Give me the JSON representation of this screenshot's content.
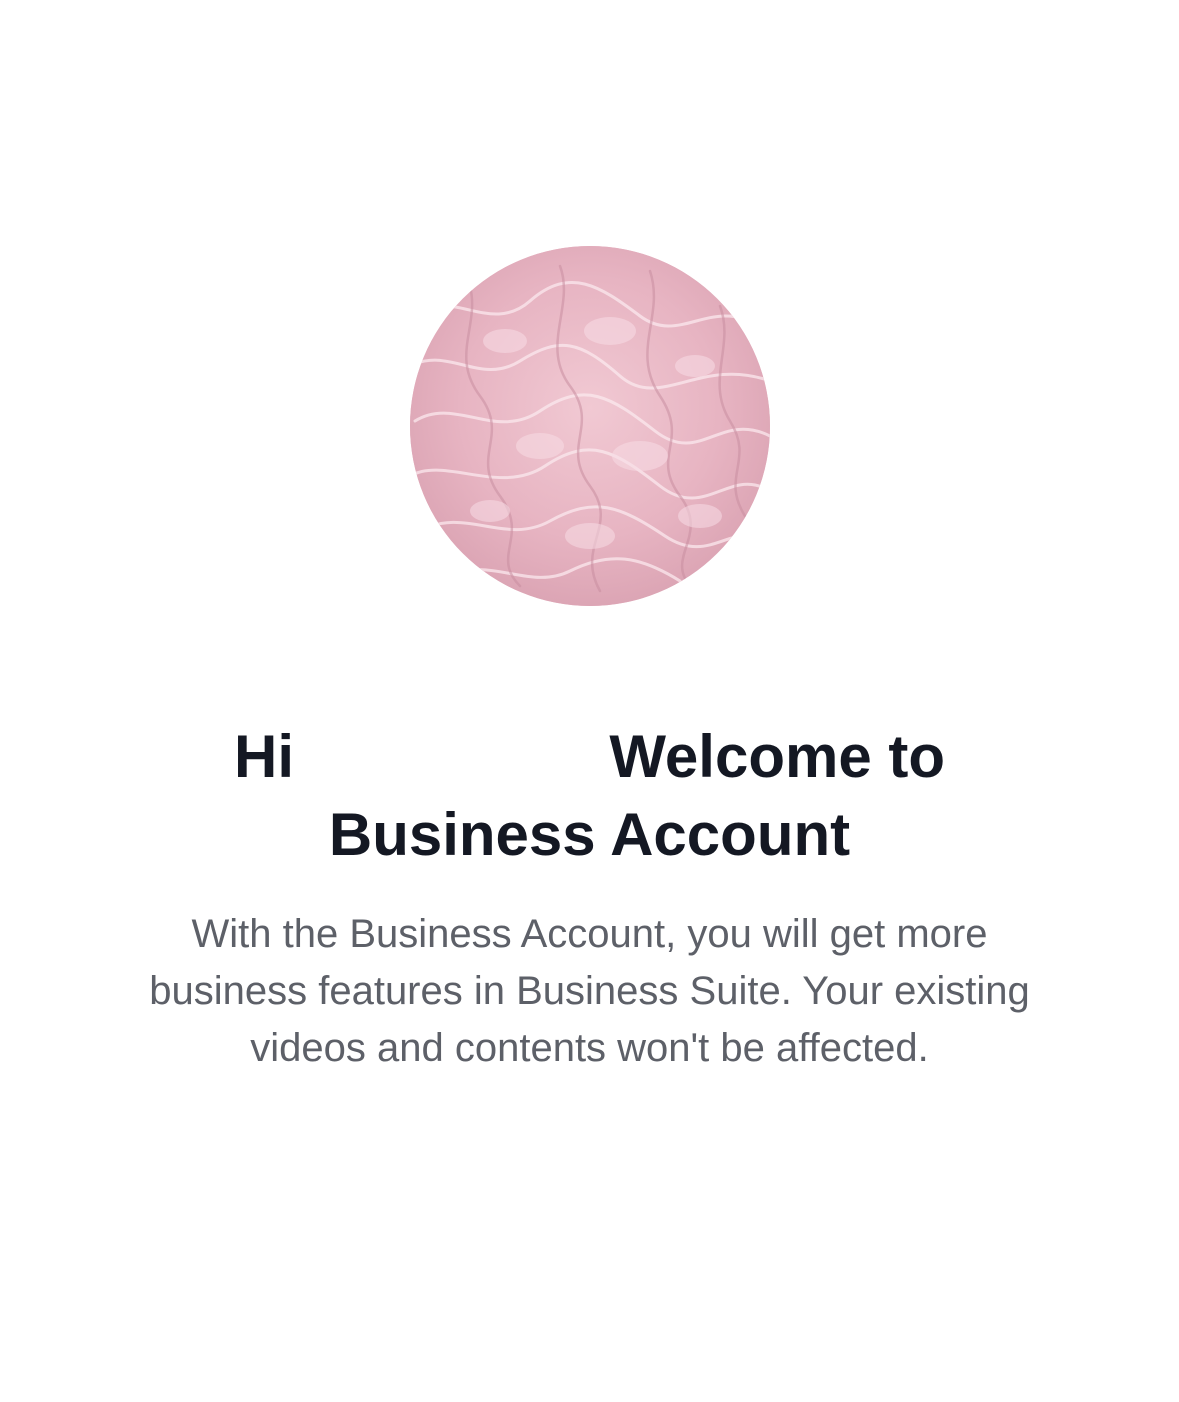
{
  "avatar": {
    "icon": "pink-water-ripple-profile-image",
    "color": "#e9b9c6"
  },
  "welcome": {
    "title_prefix": "Hi",
    "title_suffix": "Welcome to Business Account",
    "description": "With the Business Account, you will get more business features in Business Suite. Your existing videos and contents won't be affected."
  },
  "colors": {
    "title": "#141823",
    "body_text": "#5d6068",
    "background": "#ffffff"
  }
}
